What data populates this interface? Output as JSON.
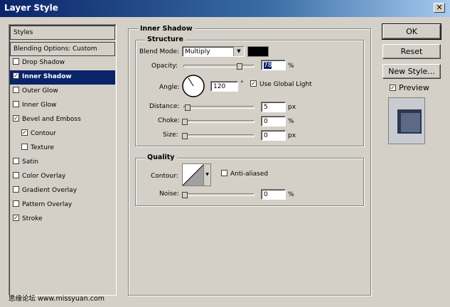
{
  "window": {
    "title": "Layer Style"
  },
  "left_panel": {
    "header": "Styles",
    "blending": "Blending Options: Custom",
    "items": [
      {
        "label": "Drop Shadow",
        "checked": false
      },
      {
        "label": "Inner Shadow",
        "checked": true
      },
      {
        "label": "Outer Glow",
        "checked": false
      },
      {
        "label": "Inner Glow",
        "checked": false
      },
      {
        "label": "Bevel and Emboss",
        "checked": true
      },
      {
        "label": "Contour",
        "checked": true
      },
      {
        "label": "Texture",
        "checked": false
      },
      {
        "label": "Satin",
        "checked": false
      },
      {
        "label": "Color Overlay",
        "checked": false
      },
      {
        "label": "Gradient Overlay",
        "checked": false
      },
      {
        "label": "Pattern Overlay",
        "checked": false
      },
      {
        "label": "Stroke",
        "checked": true
      }
    ]
  },
  "main": {
    "section_title": "Inner Shadow",
    "structure": {
      "title": "Structure",
      "blend_mode_label": "Blend Mode:",
      "blend_mode_value": "Multiply",
      "shadow_color": "#000000",
      "opacity_label": "Opacity:",
      "opacity_value": "78",
      "opacity_unit": "%",
      "angle_label": "Angle:",
      "angle_value": "120",
      "angle_unit": "°",
      "global_light_label": "Use Global Light",
      "distance_label": "Distance:",
      "distance_value": "5",
      "distance_unit": "px",
      "choke_label": "Choke:",
      "choke_value": "0",
      "choke_unit": "%",
      "size_label": "Size:",
      "size_value": "0",
      "size_unit": "px"
    },
    "quality": {
      "title": "Quality",
      "contour_label": "Contour:",
      "anti_aliased_label": "Anti-aliased",
      "noise_label": "Noise:",
      "noise_value": "0",
      "noise_unit": "%"
    }
  },
  "buttons": {
    "ok": "OK",
    "reset": "Reset",
    "new_style": "New Style...",
    "preview": "Preview"
  },
  "watermark": "思缘论坛 www.missyuan.com"
}
